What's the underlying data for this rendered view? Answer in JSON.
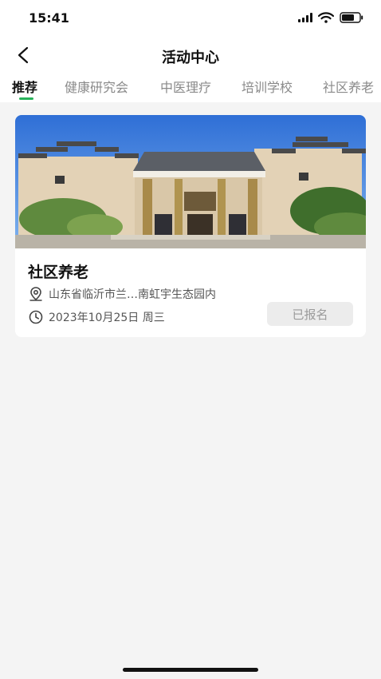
{
  "status_bar": {
    "time": "15:41",
    "icons": [
      "signal-icon",
      "wifi-icon",
      "battery-icon"
    ]
  },
  "nav": {
    "title": "活动中心",
    "back_icon": "chevron-left-icon"
  },
  "tabs": [
    {
      "label": "推荐",
      "active": true
    },
    {
      "label": "健康研究会",
      "active": false
    },
    {
      "label": "中医理疗",
      "active": false
    },
    {
      "label": "培训学校",
      "active": false
    },
    {
      "label": "社区养老",
      "active": false
    }
  ],
  "activity": {
    "title": "社区养老",
    "location": "山东省临沂市兰…南虹宇生态园内",
    "date": "2023年10月25日 周三",
    "status": "已报名",
    "location_icon": "location-pin-icon",
    "date_icon": "clock-icon"
  },
  "colors": {
    "accent": "#27b35a",
    "background": "#f4f4f4",
    "card": "#ffffff",
    "status_button_bg": "#ececec",
    "status_button_text": "#9a9a9a"
  }
}
